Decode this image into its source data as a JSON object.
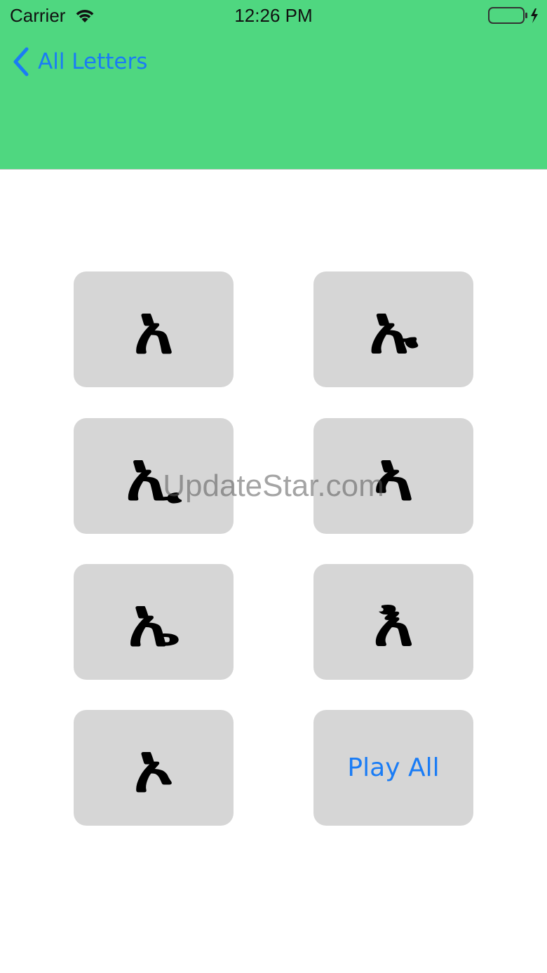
{
  "status_bar": {
    "carrier": "Carrier",
    "time": "12:26 PM",
    "wifi_icon": "wifi-icon",
    "battery_icon": "battery-charging-icon",
    "battery_level": 1.0,
    "battery_color": "#4fd780"
  },
  "nav": {
    "back_label": "All Letters",
    "back_icon": "chevron-left-icon",
    "header_color": "#4fd780",
    "accent_color": "#1a7cf5"
  },
  "letters": [
    {
      "glyph": "አ"
    },
    {
      "glyph": "ኡ"
    },
    {
      "glyph": "ኢ"
    },
    {
      "glyph": "ኣ"
    },
    {
      "glyph": "ኤ"
    },
    {
      "glyph": "እ"
    },
    {
      "glyph": "ኦ"
    }
  ],
  "play_all_label": "Play All",
  "watermark": "UpdateStar.com"
}
